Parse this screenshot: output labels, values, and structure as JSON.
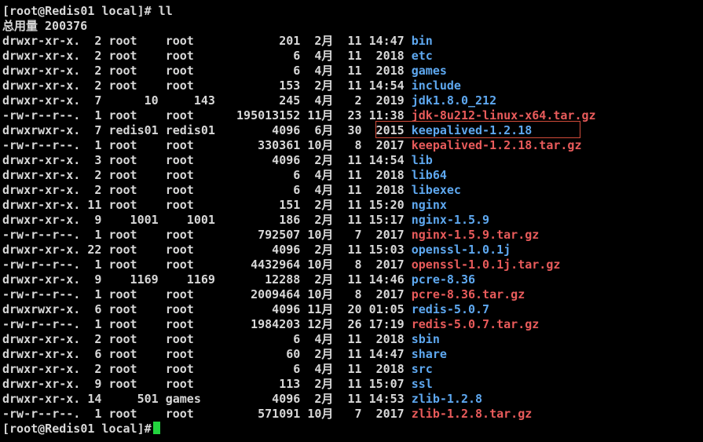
{
  "prompt_top": "[root@Redis01 local]# ll",
  "total_line": "总用量 200376",
  "colors": {
    "directory": "#5ea8f0",
    "archive": "#e85b5b",
    "cursor": "#22d43e",
    "highlight_box": "#d24b3a"
  },
  "entries": [
    {
      "perm": "drwxr-xr-x.",
      "links": "2",
      "owner": "root",
      "group": "root",
      "size": "201",
      "month": "2月",
      "day": "11",
      "time": "14:47",
      "name": "bin",
      "type": "dir"
    },
    {
      "perm": "drwxr-xr-x.",
      "links": "2",
      "owner": "root",
      "group": "root",
      "size": "6",
      "month": "4月",
      "day": "11",
      "time": "2018",
      "name": "etc",
      "type": "dir"
    },
    {
      "perm": "drwxr-xr-x.",
      "links": "2",
      "owner": "root",
      "group": "root",
      "size": "6",
      "month": "4月",
      "day": "11",
      "time": "2018",
      "name": "games",
      "type": "dir"
    },
    {
      "perm": "drwxr-xr-x.",
      "links": "2",
      "owner": "root",
      "group": "root",
      "size": "153",
      "month": "2月",
      "day": "11",
      "time": "14:54",
      "name": "include",
      "type": "dir"
    },
    {
      "perm": "drwxr-xr-x.",
      "links": "7",
      "owner": "10",
      "group": "143",
      "size": "245",
      "month": "4月",
      "day": "2",
      "time": "2019",
      "name": "jdk1.8.0_212",
      "type": "dir"
    },
    {
      "perm": "-rw-r--r--.",
      "links": "1",
      "owner": "root",
      "group": "root",
      "size": "195013152",
      "month": "11月",
      "day": "23",
      "time": "11:38",
      "name": "jdk-8u212-linux-x64.tar.gz",
      "type": "arc"
    },
    {
      "perm": "drwxrwxr-x.",
      "links": "7",
      "owner": "redis01",
      "group": "redis01",
      "size": "4096",
      "month": "6月",
      "day": "30",
      "time": "2015",
      "name": "keepalived-1.2.18",
      "type": "dir"
    },
    {
      "perm": "-rw-r--r--.",
      "links": "1",
      "owner": "root",
      "group": "root",
      "size": "330361",
      "month": "10月",
      "day": "8",
      "time": "2017",
      "name": "keepalived-1.2.18.tar.gz",
      "type": "arc"
    },
    {
      "perm": "drwxr-xr-x.",
      "links": "3",
      "owner": "root",
      "group": "root",
      "size": "4096",
      "month": "2月",
      "day": "11",
      "time": "14:54",
      "name": "lib",
      "type": "dir"
    },
    {
      "perm": "drwxr-xr-x.",
      "links": "2",
      "owner": "root",
      "group": "root",
      "size": "6",
      "month": "4月",
      "day": "11",
      "time": "2018",
      "name": "lib64",
      "type": "dir"
    },
    {
      "perm": "drwxr-xr-x.",
      "links": "2",
      "owner": "root",
      "group": "root",
      "size": "6",
      "month": "4月",
      "day": "11",
      "time": "2018",
      "name": "libexec",
      "type": "dir"
    },
    {
      "perm": "drwxr-xr-x.",
      "links": "11",
      "owner": "root",
      "group": "root",
      "size": "151",
      "month": "2月",
      "day": "11",
      "time": "15:20",
      "name": "nginx",
      "type": "dir"
    },
    {
      "perm": "drwxr-xr-x.",
      "links": "9",
      "owner": "1001",
      "group": "1001",
      "size": "186",
      "month": "2月",
      "day": "11",
      "time": "15:17",
      "name": "nginx-1.5.9",
      "type": "dir"
    },
    {
      "perm": "-rw-r--r--.",
      "links": "1",
      "owner": "root",
      "group": "root",
      "size": "792507",
      "month": "10月",
      "day": "7",
      "time": "2017",
      "name": "nginx-1.5.9.tar.gz",
      "type": "arc"
    },
    {
      "perm": "drwxr-xr-x.",
      "links": "22",
      "owner": "root",
      "group": "root",
      "size": "4096",
      "month": "2月",
      "day": "11",
      "time": "15:03",
      "name": "openssl-1.0.1j",
      "type": "dir"
    },
    {
      "perm": "-rw-r--r--.",
      "links": "1",
      "owner": "root",
      "group": "root",
      "size": "4432964",
      "month": "10月",
      "day": "8",
      "time": "2017",
      "name": "openssl-1.0.1j.tar.gz",
      "type": "arc"
    },
    {
      "perm": "drwxr-xr-x.",
      "links": "9",
      "owner": "1169",
      "group": "1169",
      "size": "12288",
      "month": "2月",
      "day": "11",
      "time": "14:46",
      "name": "pcre-8.36",
      "type": "dir"
    },
    {
      "perm": "-rw-r--r--.",
      "links": "1",
      "owner": "root",
      "group": "root",
      "size": "2009464",
      "month": "10月",
      "day": "8",
      "time": "2017",
      "name": "pcre-8.36.tar.gz",
      "type": "arc"
    },
    {
      "perm": "drwxrwxr-x.",
      "links": "6",
      "owner": "root",
      "group": "root",
      "size": "4096",
      "month": "11月",
      "day": "20",
      "time": "01:05",
      "name": "redis-5.0.7",
      "type": "dir"
    },
    {
      "perm": "-rw-r--r--.",
      "links": "1",
      "owner": "root",
      "group": "root",
      "size": "1984203",
      "month": "12月",
      "day": "26",
      "time": "17:19",
      "name": "redis-5.0.7.tar.gz",
      "type": "arc"
    },
    {
      "perm": "drwxr-xr-x.",
      "links": "2",
      "owner": "root",
      "group": "root",
      "size": "6",
      "month": "4月",
      "day": "11",
      "time": "2018",
      "name": "sbin",
      "type": "dir"
    },
    {
      "perm": "drwxr-xr-x.",
      "links": "6",
      "owner": "root",
      "group": "root",
      "size": "60",
      "month": "2月",
      "day": "11",
      "time": "14:47",
      "name": "share",
      "type": "dir"
    },
    {
      "perm": "drwxr-xr-x.",
      "links": "2",
      "owner": "root",
      "group": "root",
      "size": "6",
      "month": "4月",
      "day": "11",
      "time": "2018",
      "name": "src",
      "type": "dir"
    },
    {
      "perm": "drwxr-xr-x.",
      "links": "9",
      "owner": "root",
      "group": "root",
      "size": "113",
      "month": "2月",
      "day": "11",
      "time": "15:07",
      "name": "ssl",
      "type": "dir"
    },
    {
      "perm": "drwxr-xr-x.",
      "links": "14",
      "owner": "501",
      "group": "games",
      "size": "4096",
      "month": "2月",
      "day": "11",
      "time": "14:53",
      "name": "zlib-1.2.8",
      "type": "dir"
    },
    {
      "perm": "-rw-r--r--.",
      "links": "1",
      "owner": "root",
      "group": "root",
      "size": "571091",
      "month": "10月",
      "day": "7",
      "time": "2017",
      "name": "zlib-1.2.8.tar.gz",
      "type": "arc"
    }
  ],
  "prompt_bottom": "[root@Redis01 local]#"
}
